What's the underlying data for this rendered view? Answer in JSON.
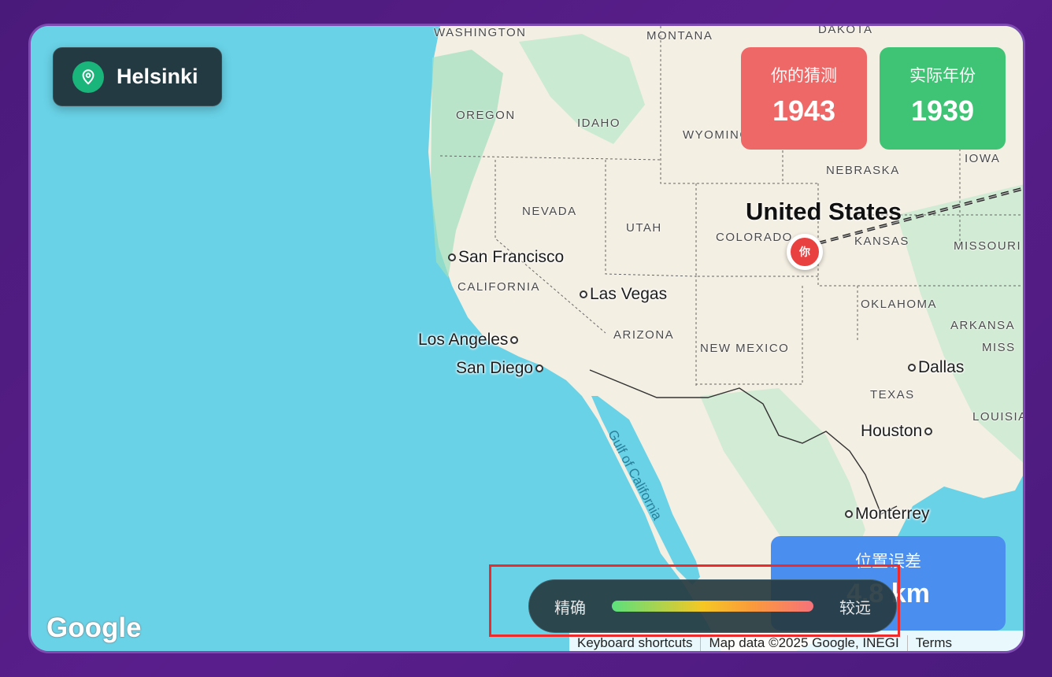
{
  "location": {
    "name": "Helsinki",
    "icon": "map-pin-icon"
  },
  "stats": {
    "guess": {
      "label": "你的猜测",
      "value": "1943"
    },
    "actual": {
      "label": "实际年份",
      "value": "1939"
    },
    "error": {
      "label": "位置误差",
      "value": "4.8 km"
    }
  },
  "scale": {
    "left": "精确",
    "right": "较远"
  },
  "marker": {
    "label": "你"
  },
  "map": {
    "country": "United States",
    "states": [
      "WASHINGTON",
      "MONTANA",
      "DAKOTA",
      "OREGON",
      "IDAHO",
      "WYOMING",
      "NEBRASKA",
      "IOWA",
      "NEVADA",
      "UTAH",
      "COLORADO",
      "KANSAS",
      "MISSOURI",
      "CALIFORNIA",
      "ARIZONA",
      "NEW MEXICO",
      "OKLAHOMA",
      "ARKANSA",
      "MISS",
      "TEXAS",
      "LOUISIA"
    ],
    "cities": [
      "San Francisco",
      "Las Vegas",
      "Los Angeles",
      "San Diego",
      "Dallas",
      "Houston",
      "Monterrey"
    ],
    "water": "Gulf of California",
    "logo": "Google",
    "attribution": [
      "Keyboard shortcuts",
      "Map data ©2025 Google, INEGI",
      "Terms"
    ]
  },
  "colors": {
    "ocean": "#69d2e7",
    "land": "#f4efe3",
    "guess": "#ef6868",
    "actual": "#3ec474",
    "error": "#4a8ef0"
  }
}
